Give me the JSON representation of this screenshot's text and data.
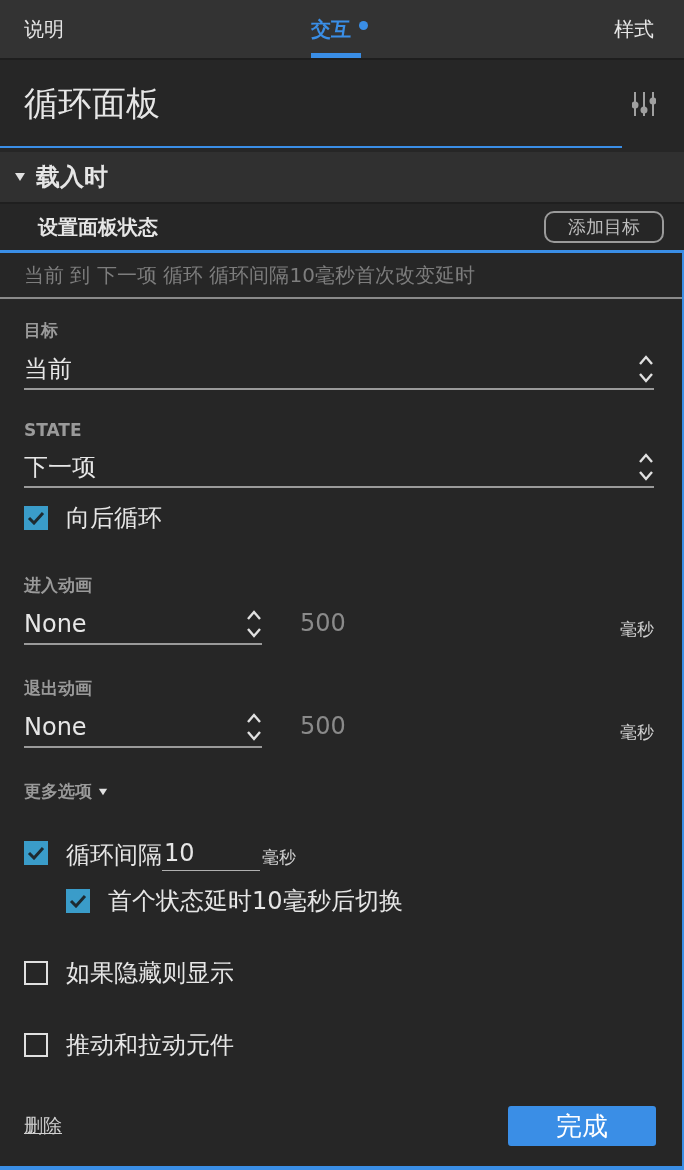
{
  "tabs": [
    {
      "label": "说明",
      "selected": false,
      "dot": false
    },
    {
      "label": "交互",
      "selected": true,
      "dot": true
    },
    {
      "label": "样式",
      "selected": false,
      "dot": false
    }
  ],
  "title": "循环面板",
  "section": {
    "label": "载入时",
    "expanded": true
  },
  "action": {
    "label": "设置面板状态",
    "button": "添加目标"
  },
  "summary": "当前 到 下一项 循环 循环间隔10毫秒首次改变延时",
  "target": {
    "label": "目标",
    "value": "当前"
  },
  "state": {
    "label": "STATE",
    "value": "下一项"
  },
  "wrap": {
    "label": "向后循环",
    "checked": true
  },
  "animations": [
    {
      "label": "进入动画",
      "value": "None",
      "duration": "500",
      "unit": "毫秒"
    },
    {
      "label": "退出动画",
      "value": "None",
      "duration": "500",
      "unit": "毫秒"
    }
  ],
  "more_options": {
    "label": "更多选项",
    "expanded": true
  },
  "options": [
    {
      "kind": "interval",
      "label": "循环间隔",
      "value": "10",
      "unit": "毫秒",
      "checked": true,
      "children": [
        {
          "kind": "plain",
          "label": "首个状态延时10毫秒后切换",
          "checked": true
        }
      ]
    },
    {
      "kind": "plain",
      "label": "如果隐藏则显示",
      "checked": false
    },
    {
      "kind": "plain",
      "label": "推动和拉动元件",
      "checked": false
    }
  ],
  "footer": {
    "delete": "删除",
    "done": "完成"
  }
}
